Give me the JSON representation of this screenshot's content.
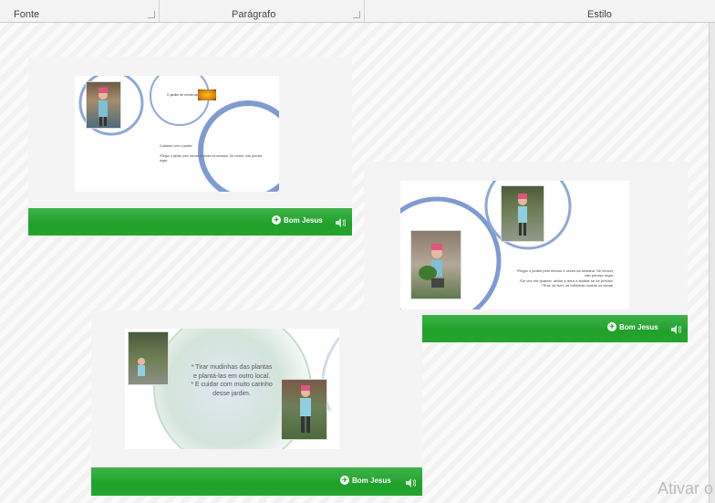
{
  "ribbon": {
    "groups": [
      "Fonte",
      "Parágrafo",
      "Estilo"
    ]
  },
  "slide1": {
    "title": "O jardim de minha casa",
    "subtitle": "Cuidados com o jardim",
    "body": "*Regar o jardim pelo menos 4 vezes na semana. Se chover, não precisa regar.",
    "brand": "Bom Jesus"
  },
  "slide2": {
    "lines": [
      "*Regar o jardim pelo menos 4 vezes na semana. Se chover,",
      "não precisa regar.",
      "*De vez em quando, afofar a terra e adubar se for preciso.",
      "*Tirar, se tiver, as folhinhas mortas ou secas."
    ],
    "brand": "Bom Jesus"
  },
  "slide3": {
    "lines": [
      "* Tirar mudinhas das plantas",
      "e plantá-las em outro local.",
      "* E cuidar com muito carinho",
      "desse jardim."
    ],
    "brand": "Bom Jesus"
  },
  "watermark": "Ativar o"
}
